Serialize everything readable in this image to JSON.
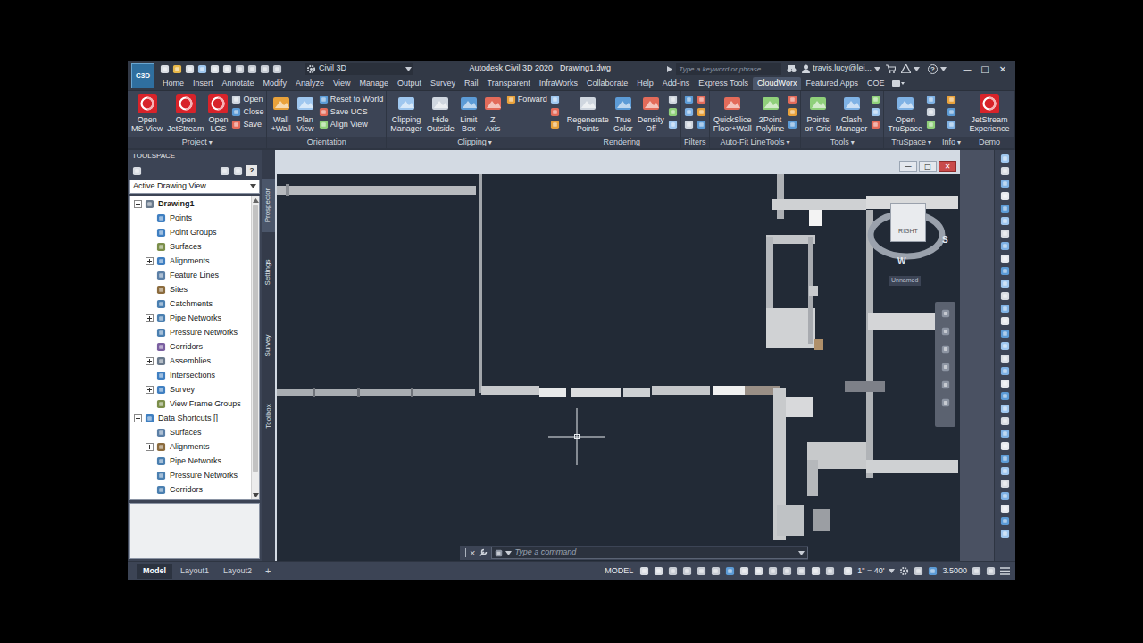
{
  "title_bar": {
    "logo": "C3D",
    "workspace": "Civil 3D",
    "app_title": "Autodesk Civil 3D 2020",
    "document": "Drawing1.dwg",
    "search_placeholder": "Type a keyword or phrase",
    "user": "travis.lucy@lei...",
    "help": "?",
    "window_controls": [
      "—",
      "□",
      "✕"
    ]
  },
  "ribbon_tabs": [
    {
      "label": "Home",
      "selected": false
    },
    {
      "label": "Insert",
      "selected": false
    },
    {
      "label": "Annotate",
      "selected": false
    },
    {
      "label": "Modify",
      "selected": false
    },
    {
      "label": "Analyze",
      "selected": false
    },
    {
      "label": "View",
      "selected": false
    },
    {
      "label": "Manage",
      "selected": false
    },
    {
      "label": "Output",
      "selected": false
    },
    {
      "label": "Survey",
      "selected": false
    },
    {
      "label": "Rail",
      "selected": false
    },
    {
      "label": "Transparent",
      "selected": false
    },
    {
      "label": "InfraWorks",
      "selected": false
    },
    {
      "label": "Collaborate",
      "selected": false
    },
    {
      "label": "Help",
      "selected": false
    },
    {
      "label": "Add-ins",
      "selected": false
    },
    {
      "label": "Express Tools",
      "selected": false
    },
    {
      "label": "CloudWorx",
      "selected": true
    },
    {
      "label": "Featured Apps",
      "selected": false
    },
    {
      "label": "COE",
      "selected": false
    }
  ],
  "ribbon_panels": [
    {
      "title": "Project",
      "arrow": "▾",
      "tools": [
        {
          "kind": "large",
          "lines": [
            "Open",
            "MS View"
          ]
        },
        {
          "kind": "large",
          "lines": [
            "Open",
            "JetStream"
          ]
        },
        {
          "kind": "large",
          "lines": [
            "Open",
            "LGS"
          ]
        },
        {
          "kind": "small",
          "label": "Open"
        },
        {
          "kind": "small",
          "label": "Close"
        },
        {
          "kind": "small",
          "label": "Save"
        }
      ]
    },
    {
      "title": "Orientation",
      "tools": [
        {
          "kind": "large",
          "lines": [
            "Wall",
            "+Wall"
          ]
        },
        {
          "kind": "large",
          "lines": [
            "Plan",
            "View"
          ]
        },
        {
          "kind": "small",
          "label": "Reset to World"
        },
        {
          "kind": "small",
          "label": "Save UCS"
        },
        {
          "kind": "small",
          "label": "Align View"
        }
      ]
    },
    {
      "title": "Clipping",
      "arrow": "▾",
      "tools": [
        {
          "kind": "large",
          "lines": [
            "Clipping",
            "Manager"
          ]
        },
        {
          "kind": "large",
          "lines": [
            "Hide",
            "Outside"
          ]
        },
        {
          "kind": "large",
          "lines": [
            "Limit",
            "Box"
          ]
        },
        {
          "kind": "large",
          "lines": [
            "Z",
            "Axis"
          ]
        },
        {
          "kind": "small",
          "label": "Forward"
        }
      ]
    },
    {
      "title": "Rendering",
      "tools": [
        {
          "kind": "large",
          "lines": [
            "Regenerate",
            "Points"
          ]
        },
        {
          "kind": "large",
          "lines": [
            "True",
            "Color"
          ]
        },
        {
          "kind": "large",
          "lines": [
            "Density",
            "Off"
          ]
        }
      ]
    },
    {
      "title": "Filters",
      "tools": []
    },
    {
      "title": "Auto-Fit LineTools",
      "arrow": "▾",
      "tools": [
        {
          "kind": "large",
          "lines": [
            "QuickSlice",
            "Floor+Wall"
          ]
        },
        {
          "kind": "large",
          "lines": [
            "2Point",
            "Polyline"
          ]
        }
      ]
    },
    {
      "title": "Tools",
      "arrow": "▾",
      "tools": [
        {
          "kind": "large",
          "lines": [
            "Points",
            "on Grid"
          ]
        },
        {
          "kind": "large",
          "lines": [
            "Clash",
            "Manager"
          ]
        }
      ]
    },
    {
      "title": "TruSpace",
      "arrow": "▾",
      "tools": [
        {
          "kind": "large",
          "lines": [
            "Open",
            "TruSpace"
          ]
        }
      ]
    },
    {
      "title": "Info",
      "arrow": "▾",
      "tools": []
    },
    {
      "title": "Demo",
      "tools": [
        {
          "kind": "large",
          "lines": [
            "JetStream",
            "Experience"
          ]
        }
      ]
    }
  ],
  "toolspace": {
    "title": "TOOLSPACE",
    "help": "?",
    "view": "Active Drawing View",
    "tree": [
      {
        "label": "Drawing1",
        "depth": 0,
        "kind": "parent",
        "expanded": true,
        "active": true
      },
      {
        "label": "Points",
        "depth": 1,
        "kind": "leaf",
        "active": false
      },
      {
        "label": "Point Groups",
        "depth": 1,
        "kind": "leaf",
        "active": false
      },
      {
        "label": "Surfaces",
        "depth": 1,
        "kind": "leaf",
        "active": false
      },
      {
        "label": "Alignments",
        "depth": 1,
        "kind": "parent",
        "expanded": false,
        "active": false
      },
      {
        "label": "Feature Lines",
        "depth": 1,
        "kind": "leaf",
        "active": false
      },
      {
        "label": "Sites",
        "depth": 1,
        "kind": "leaf",
        "active": false
      },
      {
        "label": "Catchments",
        "depth": 1,
        "kind": "leaf",
        "active": false
      },
      {
        "label": "Pipe Networks",
        "depth": 1,
        "kind": "parent",
        "expanded": false,
        "active": false
      },
      {
        "label": "Pressure Networks",
        "depth": 1,
        "kind": "leaf",
        "active": false
      },
      {
        "label": "Corridors",
        "depth": 1,
        "kind": "leaf",
        "active": false
      },
      {
        "label": "Assemblies",
        "depth": 1,
        "kind": "parent",
        "expanded": false,
        "active": false
      },
      {
        "label": "Intersections",
        "depth": 1,
        "kind": "leaf",
        "active": false
      },
      {
        "label": "Survey",
        "depth": 1,
        "kind": "parent",
        "expanded": false,
        "active": false
      },
      {
        "label": "View Frame Groups",
        "depth": 1,
        "kind": "leaf",
        "active": false
      },
      {
        "label": "Data Shortcuts []",
        "depth": 0,
        "kind": "parent",
        "expanded": true,
        "active": false
      },
      {
        "label": "Surfaces",
        "depth": 1,
        "kind": "leaf",
        "active": false
      },
      {
        "label": "Alignments",
        "depth": 1,
        "kind": "parent",
        "expanded": false,
        "active": false
      },
      {
        "label": "Pipe Networks",
        "depth": 1,
        "kind": "leaf",
        "active": false
      },
      {
        "label": "Pressure Networks",
        "depth": 1,
        "kind": "leaf",
        "active": false
      },
      {
        "label": "Corridors",
        "depth": 1,
        "kind": "leaf",
        "active": false
      }
    ],
    "side_tabs": [
      {
        "label": "Prospector",
        "selected": true
      },
      {
        "label": "Settings",
        "selected": false
      },
      {
        "label": "Survey",
        "selected": false
      },
      {
        "label": "Toolbox",
        "selected": false
      }
    ]
  },
  "viewport": {
    "window_controls": [
      "—",
      "□",
      "✕"
    ],
    "viewcube": {
      "face": "RIGHT",
      "compass": [
        "S",
        "W"
      ],
      "view_name": "Unnamed"
    }
  },
  "command_line": {
    "close": "×",
    "placeholder": "Type a command"
  },
  "layout_tabs": [
    {
      "label": "Model",
      "selected": true
    },
    {
      "label": "Layout1",
      "selected": false
    },
    {
      "label": "Layout2",
      "selected": false
    }
  ],
  "layout_add": "+",
  "status_bar": {
    "mode": "MODEL",
    "scale": "1\" = 40'",
    "value": "3.5000"
  }
}
